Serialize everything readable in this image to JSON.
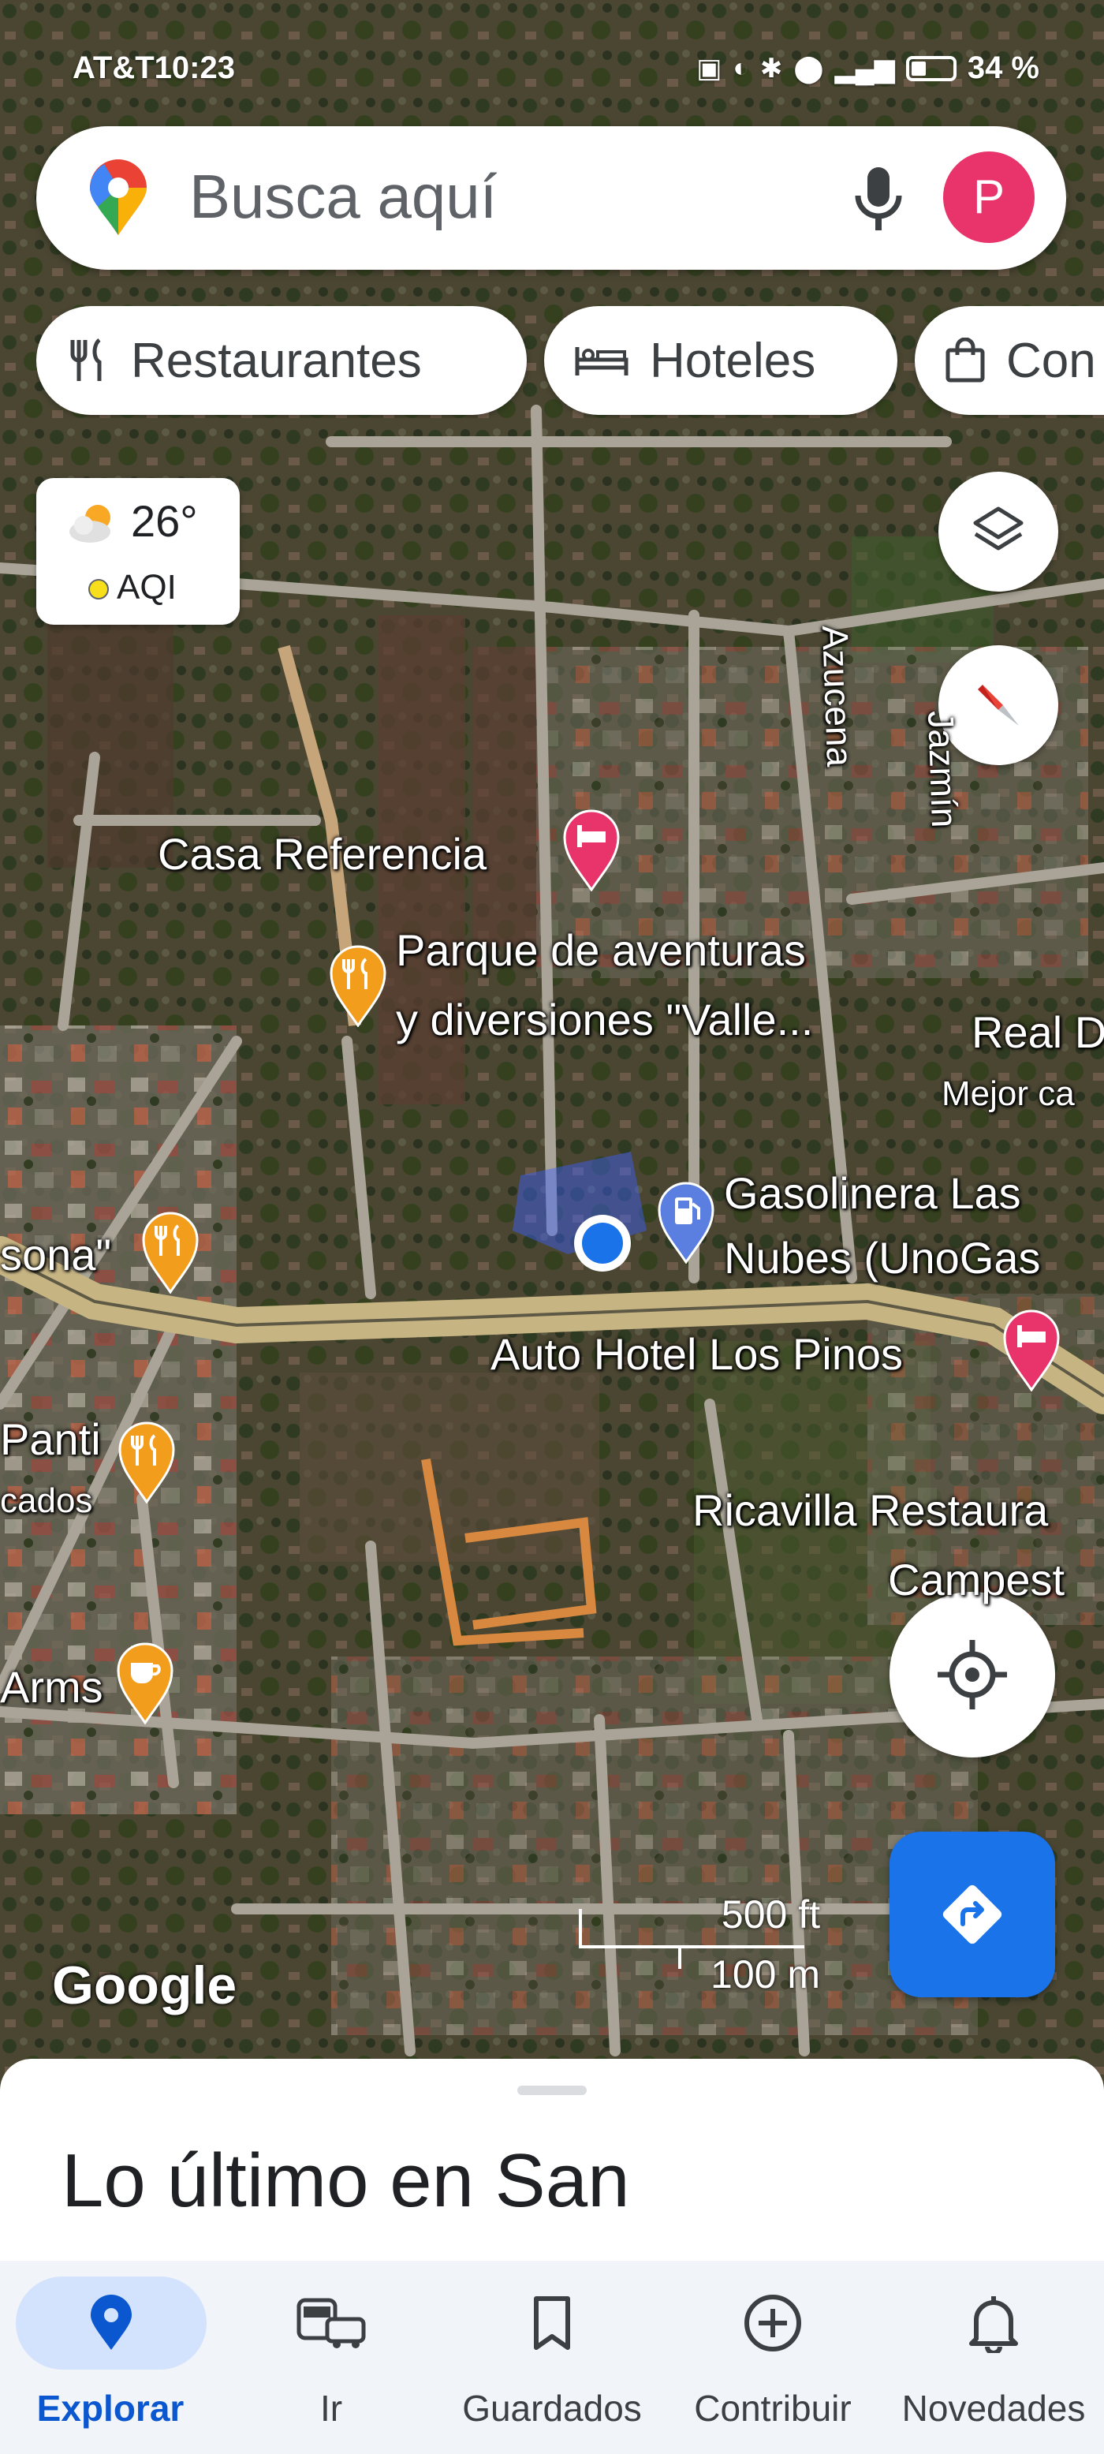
{
  "status_bar": {
    "carrier": "AT&T",
    "time": "10:23",
    "battery": "34 %"
  },
  "search": {
    "placeholder": "Busca aquí",
    "avatar_letter": "P",
    "icons": [
      "google-maps-pin-icon",
      "microphone-icon"
    ]
  },
  "chips": [
    {
      "label": "Restaurantes",
      "icon": "fork-knife-icon"
    },
    {
      "label": "Hoteles",
      "icon": "bed-icon"
    },
    {
      "label": "Con",
      "icon": "shopping-bag-icon"
    }
  ],
  "weather": {
    "temp": "26°",
    "aqi_label": "AQI",
    "icon": "partly-cloudy-icon"
  },
  "map": {
    "labels": {
      "casa_referencia": "Casa Referencia",
      "parque_line1": "Parque de aventuras",
      "parque_line2": "y diversiones \"Valle...",
      "real": "Real D",
      "mejor": "Mejor ca",
      "gasolinera_line1": "Gasolinera Las",
      "gasolinera_line2": "Nubes (UnoGas",
      "auto_hotel": "Auto Hotel Los Pinos",
      "sona": "sona\"",
      "panti": "Panti",
      "cados": "cados",
      "ricavilla": "Ricavilla Restaura",
      "campest": "Campest",
      "arms": "Arms",
      "street_azucena": "Azucena",
      "street_jazmin": "Jazmín"
    },
    "scale_ft": "500 ft",
    "scale_m": "100 m",
    "attribution": "Google"
  },
  "sheet": {
    "title": "Lo último en San"
  },
  "bottom_nav": [
    {
      "label": "Explorar",
      "icon": "location-pin-icon",
      "active": true
    },
    {
      "label": "Ir",
      "icon": "commute-icon",
      "active": false
    },
    {
      "label": "Guardados",
      "icon": "bookmark-icon",
      "active": false
    },
    {
      "label": "Contribuir",
      "icon": "add-circle-icon",
      "active": false
    },
    {
      "label": "Novedades",
      "icon": "bell-icon",
      "active": false
    }
  ],
  "colors": {
    "accent": "#1a73e8",
    "avatar": "#e8336b",
    "poi_food": "#f29d1c",
    "poi_hotel": "#e8336b",
    "poi_gas": "#5b7fe0"
  }
}
